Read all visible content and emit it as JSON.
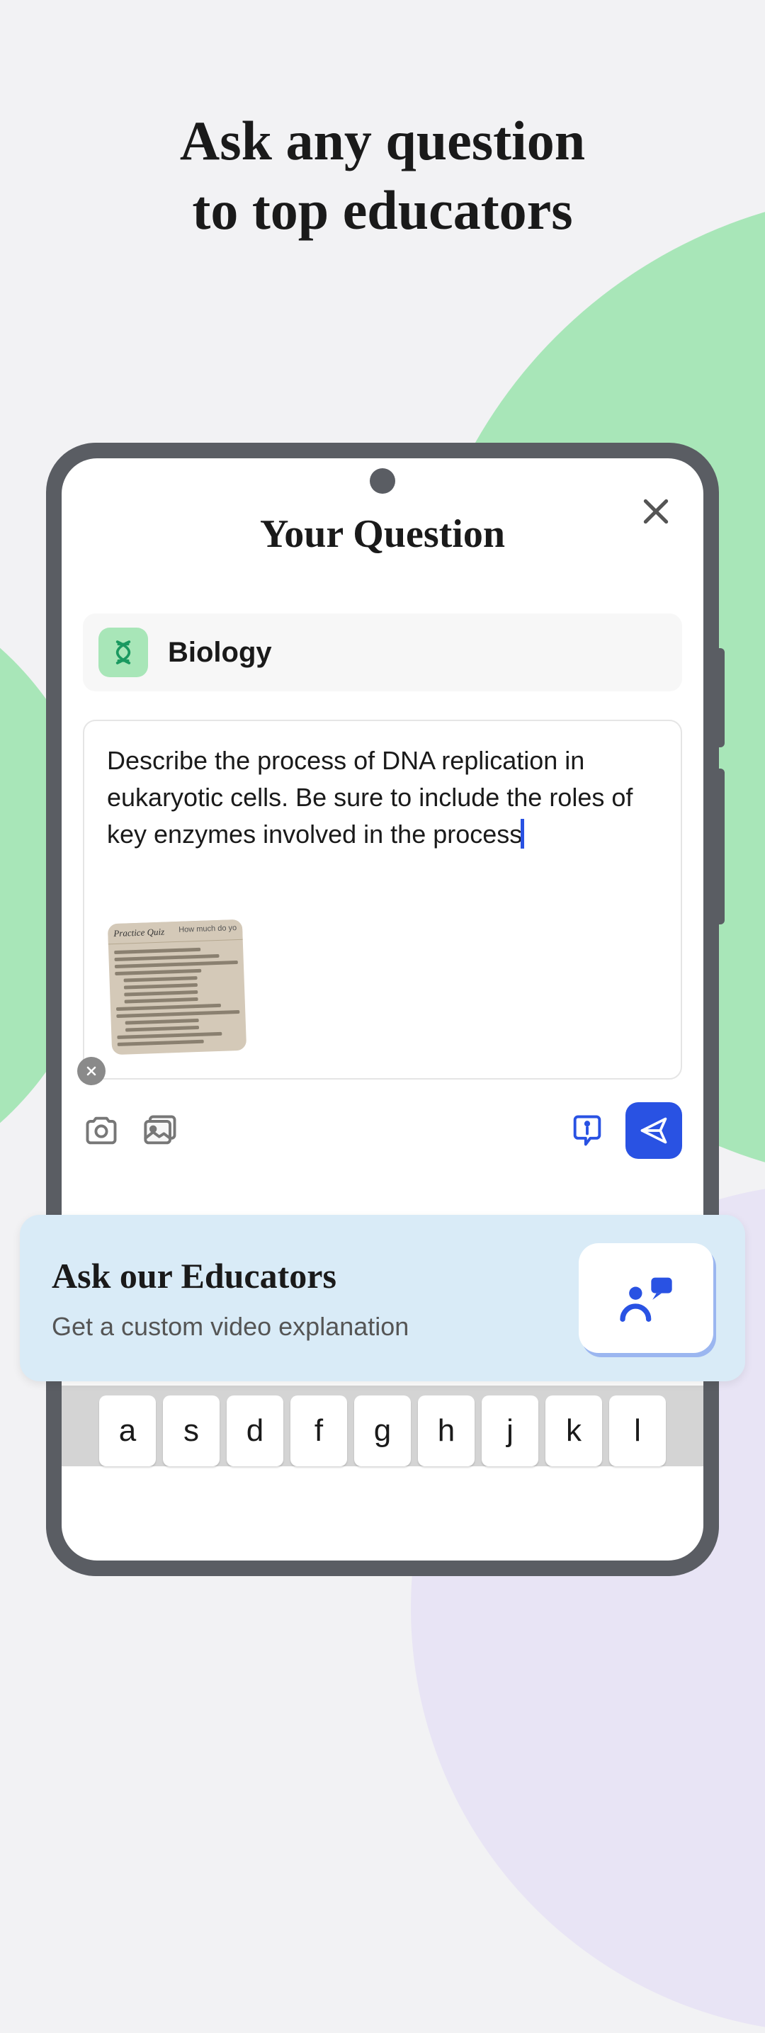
{
  "headline": {
    "line1": "Ask any question",
    "line2": "to top educators"
  },
  "screen": {
    "title": "Your Question",
    "subject": "Biology",
    "question_text": "Describe the process of DNA replication in eukaryotic cells. Be sure to include the roles of key enzymes involved in the process",
    "attachment": {
      "title": "Practice Quiz",
      "prompt": "How much do yo"
    }
  },
  "educator_card": {
    "title": "Ask our Educators",
    "subtitle": "Get a custom video explanation"
  },
  "keyboard": {
    "keys": [
      "a",
      "s",
      "d",
      "f",
      "g",
      "h",
      "j",
      "k",
      "l"
    ]
  },
  "colors": {
    "accent_blue": "#2952e3",
    "accent_green": "#a8e6b8",
    "card_blue": "#d9ebf7"
  }
}
